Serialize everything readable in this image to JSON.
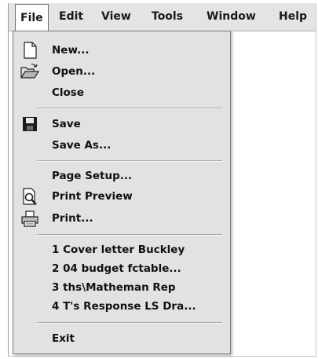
{
  "menubar": {
    "items": [
      {
        "label": "File"
      },
      {
        "label": "Edit"
      },
      {
        "label": "View"
      },
      {
        "label": "Tools"
      },
      {
        "label": "Window"
      },
      {
        "label": "Help"
      }
    ]
  },
  "file_menu": {
    "new_label": "New...",
    "open_label": "Open...",
    "close_label": "Close",
    "save_label": "Save",
    "save_as_label": "Save As...",
    "page_setup_label": "Page Setup...",
    "print_preview_label": "Print Preview",
    "print_label": "Print...",
    "recent_files": [
      {
        "label": "1 Cover letter Buckley"
      },
      {
        "label": "2 04 budget fctable..."
      },
      {
        "label": "3 ths\\Matheman Rep"
      },
      {
        "label": "4 T's Response LS Dra..."
      }
    ],
    "exit_label": "Exit"
  },
  "icons": {
    "new": "new-document-icon",
    "open": "open-folder-icon",
    "save": "floppy-disk-icon",
    "print_preview": "print-preview-icon",
    "print": "printer-icon"
  },
  "colors": {
    "menu_background": "#e2e2e2",
    "menubar_background": "#e4e4e4",
    "text": "#111111"
  }
}
